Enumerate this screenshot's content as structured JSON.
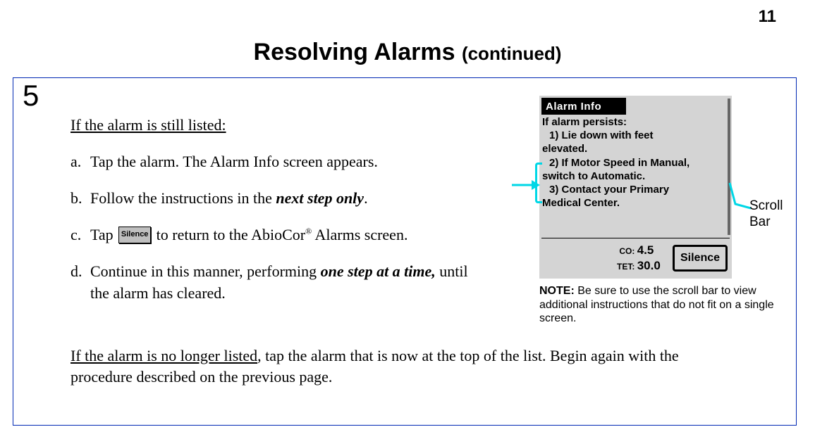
{
  "page_number": "11",
  "title_main": "Resolving Alarms ",
  "title_cont": "(continued)",
  "step_number": "5",
  "heading_still_listed": "If the alarm is still listed:",
  "items": {
    "a": {
      "letter": "a.",
      "text": "Tap the alarm. The Alarm Info screen appears."
    },
    "b": {
      "letter": "b.",
      "pre": "Follow the instructions in the ",
      "emph": "next step only",
      "post": "."
    },
    "c": {
      "letter": "c.",
      "pre": "Tap ",
      "inline_button": "Silence",
      "mid": "  to return to the AbioCor",
      "sup": "®",
      "post": " Alarms screen."
    },
    "d": {
      "letter": "d.",
      "pre": "Continue in this manner, performing ",
      "emph": "one step at a time,",
      "post": " until the alarm has cleared."
    }
  },
  "no_longer": {
    "lead": "If the alarm is no longer listed",
    "rest": ", tap the alarm that is now at the top of the list. Begin again with the procedure described on the previous page."
  },
  "device": {
    "title": "Alarm Info",
    "line1": "If alarm persists:",
    "line2": "1) Lie down with feet",
    "line3": "elevated.",
    "line4": "2) If Motor Speed in Manual,",
    "line5": "switch to Automatic.",
    "line6": "3) Contact your Primary",
    "line7": "Medical Center.",
    "co_label": "CO:",
    "co_value": "4.5",
    "tet_label": "TET:",
    "tet_value": "30.0",
    "silence": "Silence"
  },
  "scroll_label_1": "Scroll",
  "scroll_label_2": "Bar",
  "note_label": "NOTE:",
  "note_text": "  Be sure to use the scroll bar to view additional instructions that do not fit on a single screen."
}
